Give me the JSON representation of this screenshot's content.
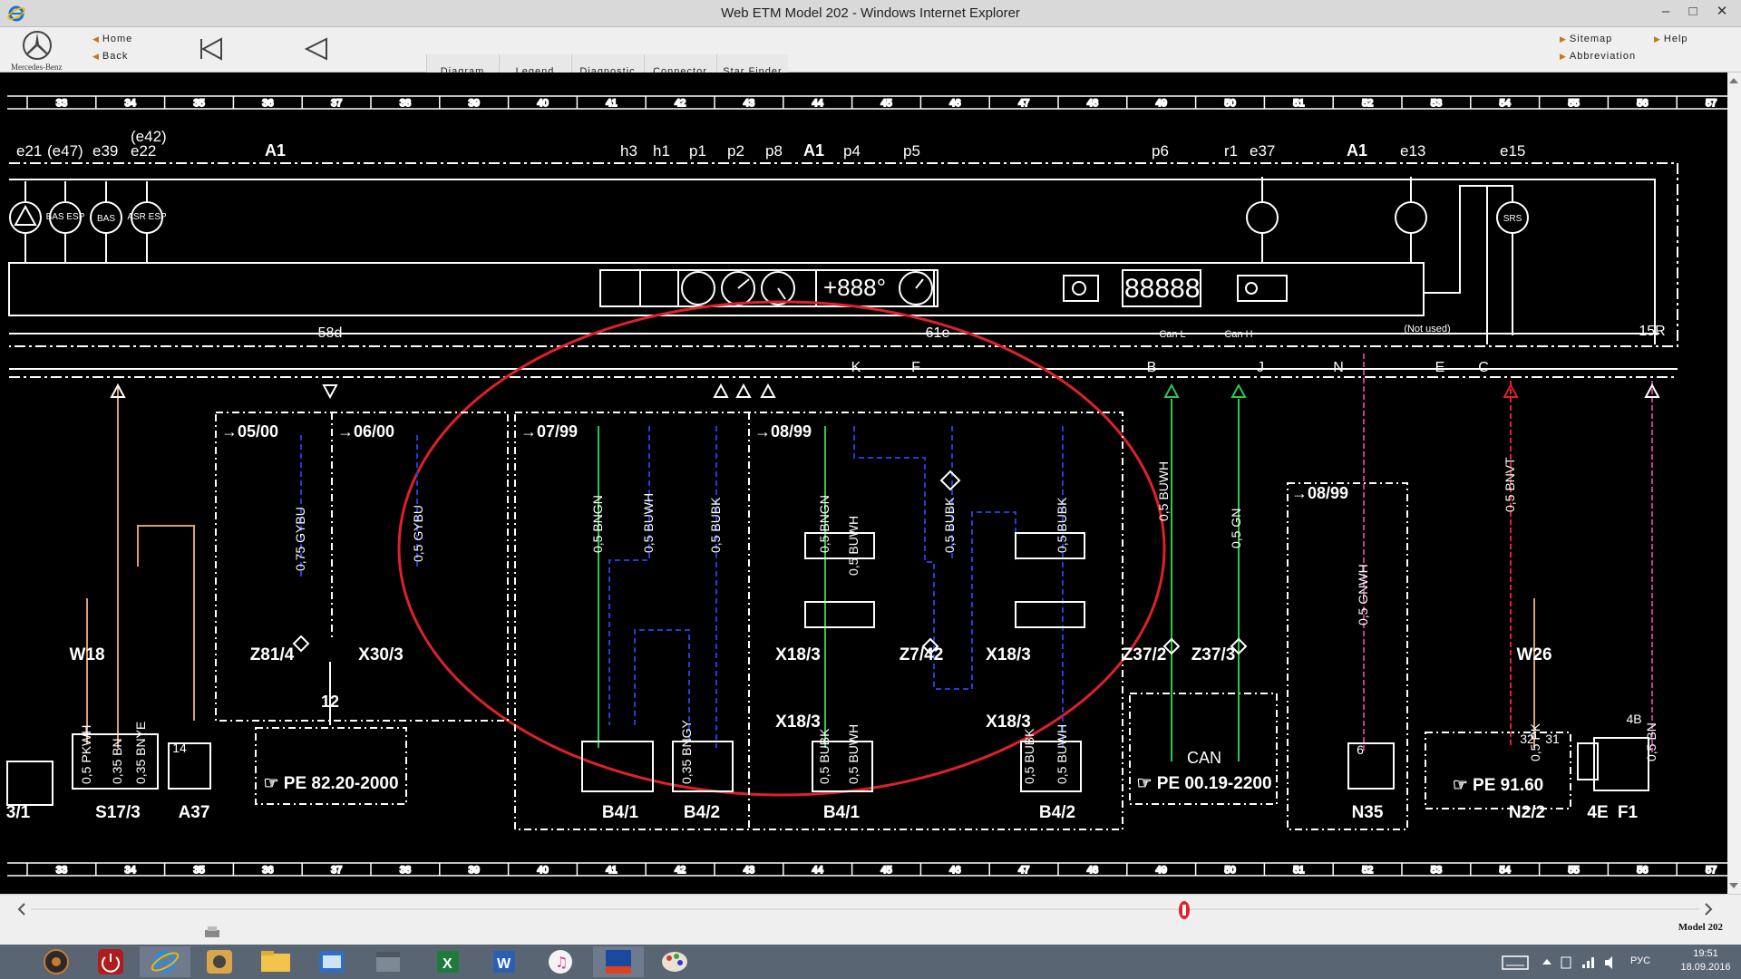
{
  "window": {
    "title": "Web ETM Model 202 - Windows Internet Explorer"
  },
  "toolbar": {
    "brand": "Mercedes-Benz",
    "home_label": "Home",
    "back_label": "Back",
    "tabs": [
      {
        "label": "Diagram",
        "accent": "#e3c000"
      },
      {
        "label": "Legend",
        "accent": "#1b36b8"
      },
      {
        "label": "Diagnostic",
        "accent": "#1b36b8"
      },
      {
        "label": "Connector",
        "accent": "#1b36b8"
      },
      {
        "label": "Star Finder",
        "accent": "#1b36b8"
      }
    ],
    "sitemap_label": "Sitemap",
    "help_label": "Help",
    "abbreviation_label": "Abbreviation"
  },
  "diagram": {
    "grid_numbers": [
      "33",
      "34",
      "35",
      "36",
      "37",
      "38",
      "39",
      "40",
      "41",
      "42",
      "43",
      "44",
      "45",
      "46",
      "47",
      "48",
      "49",
      "50",
      "51",
      "52",
      "53",
      "54",
      "55",
      "56",
      "57"
    ],
    "top_labels": [
      "e21",
      "(e47)",
      "e39",
      "(e42)",
      "e22",
      "A1",
      "h3",
      "h1",
      "p1",
      "p2",
      "p8",
      "A1",
      "p4",
      "p5",
      "p6",
      "r1",
      "e37",
      "A1",
      "e13",
      "e15"
    ],
    "indicator_labels": [
      "BAS ESP",
      "BAS",
      "ASR ESP",
      "SRS"
    ],
    "display_text": [
      "+888°",
      "88888"
    ],
    "pin_labels": [
      "58d",
      "61e",
      "Can L",
      "Can H",
      "(Not used)",
      "15R",
      "K",
      "F",
      "B",
      "J",
      "N",
      "E",
      "C"
    ],
    "date_labels": [
      "05/00",
      "06/00",
      "07/99",
      "08/99",
      "08/99"
    ],
    "wire_labels": [
      "0,75 GYBU",
      "0,5 GYBU",
      "0,5 BNGN",
      "0,5 BUWH",
      "0,5 BUBK",
      "0,5 BNGN",
      "0,5 BUWH",
      "0,5 BUBK",
      "0,5 BUBK",
      "0,5 BUWH",
      "0,5 BUBK",
      "0,5 BUWH",
      "0,5 BUBK",
      "0,5 BUWH",
      "0,5 GN",
      "0,5 GNWH",
      "0,5 BNVT",
      "0,5 PK",
      "0,5 BN",
      "0,5 PKWH",
      "0,35 BN",
      "0,35 BNYE",
      "0,35 BNGY"
    ],
    "component_labels": [
      "Z81/4",
      "X30/3",
      "X18/3",
      "Z7/42",
      "X18/3",
      "X18/3",
      "X18/3",
      "Z37/2",
      "Z37/3",
      "W18",
      "W26",
      "S17/3",
      "A37",
      "B4/1",
      "B4/2",
      "B4/1",
      "B4/2",
      "N35",
      "N2/2",
      "4E",
      "F1",
      "3/1"
    ],
    "reference_boxes": [
      "PE 82.20-2000",
      "PE 00.19-2200",
      "PE 91.60"
    ],
    "can_label": "CAN",
    "misc_numbers": [
      "12",
      "4B",
      "14",
      "32",
      "31",
      "6"
    ],
    "highlight_color": "#e0202a"
  },
  "status": {
    "model_label": "Model 202"
  },
  "taskbar": {
    "lang": "РУС",
    "time": "19:51",
    "date": "18.09.2016"
  }
}
